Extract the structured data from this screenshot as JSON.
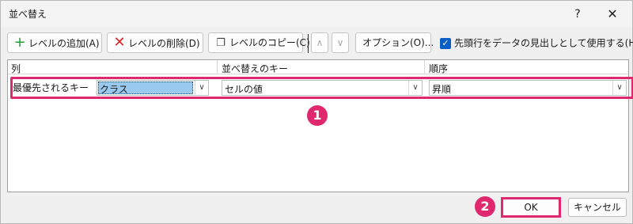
{
  "window": {
    "title": "並べ替え",
    "help_icon": "?",
    "close_icon": "✕"
  },
  "toolbar": {
    "add_label": "レベルの追加(A)",
    "delete_label": "レベルの削除(D)",
    "copy_label": "レベルのコピー(C)",
    "up_icon": "∧",
    "down_icon": "∨",
    "options_label": "オプション(O)...",
    "header_checkbox_label": "先頭行をデータの見出しとして使用する(H)",
    "header_checkbox_checked": true
  },
  "grid": {
    "headers": {
      "column": "列",
      "sort_on": "並べ替えのキー",
      "order": "順序"
    },
    "rows": [
      {
        "label": "最優先されるキー",
        "column_value": "クラス",
        "sort_on_value": "セルの値",
        "order_value": "昇順"
      }
    ]
  },
  "annotations": {
    "badge1": "1",
    "badge2": "2",
    "accent_color": "#e0286e"
  },
  "footer": {
    "ok_label": "OK",
    "cancel_label": "キャンセル"
  }
}
